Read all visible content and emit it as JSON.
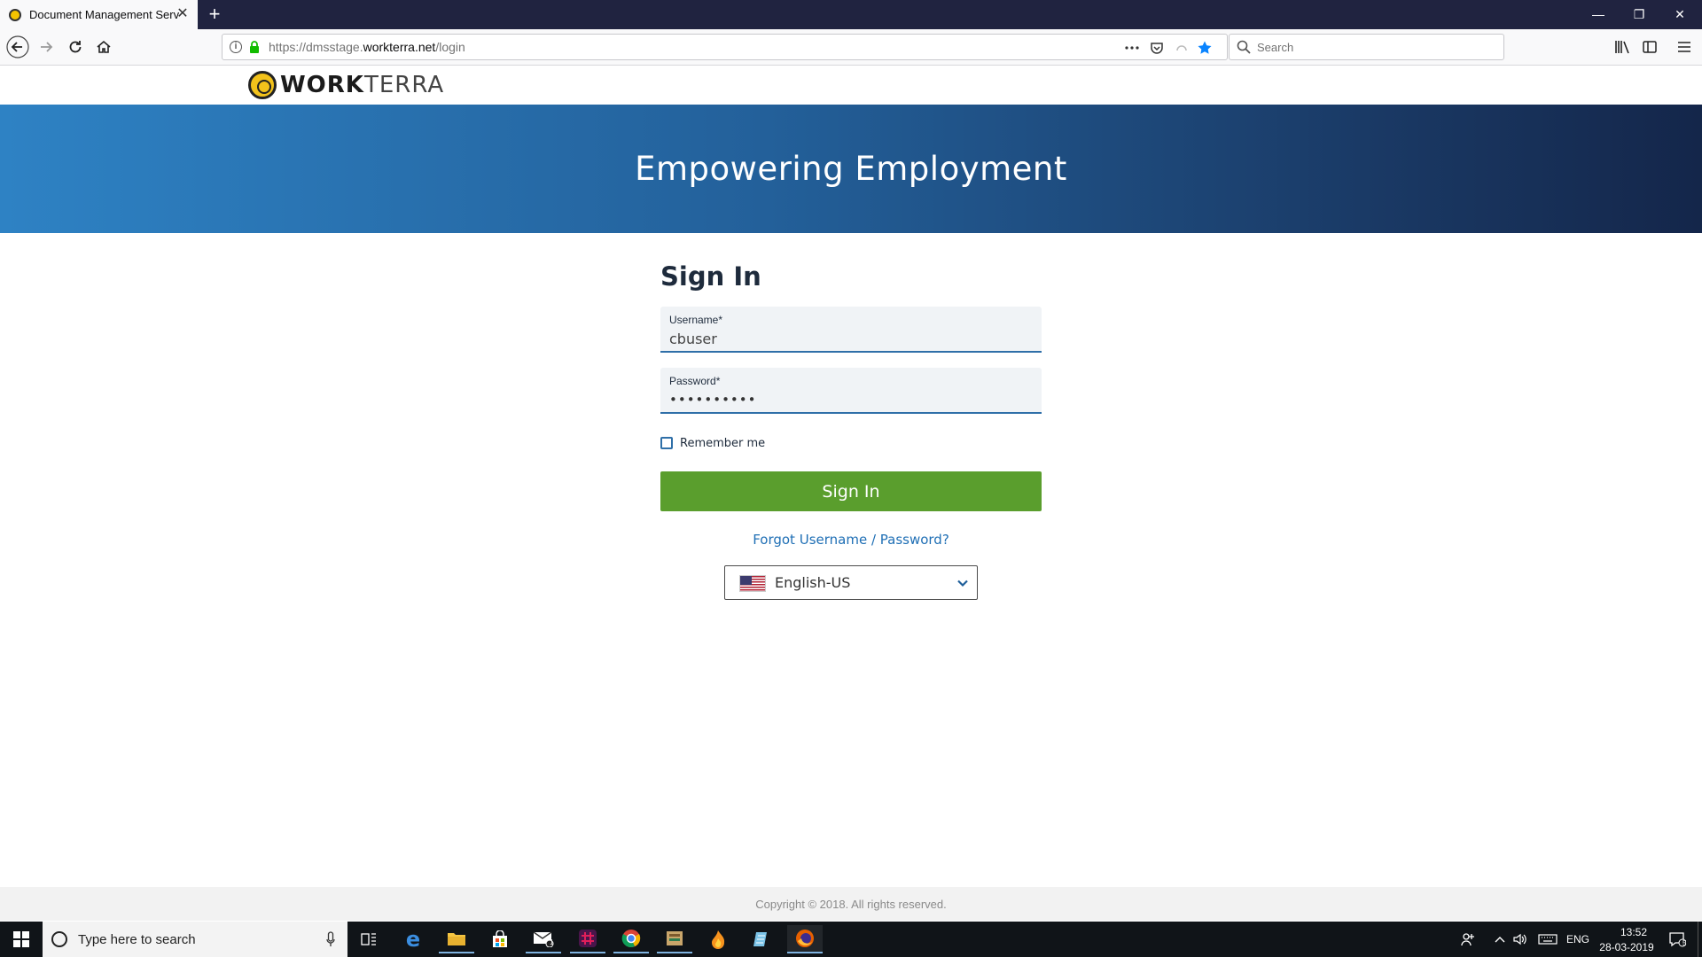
{
  "browser": {
    "tab_title": "Document Management Servic",
    "url_prefix": "https://dmsstage.",
    "url_host": "workterra.net",
    "url_path": "/login",
    "search_placeholder": "Search"
  },
  "site": {
    "logo_bold": "WORK",
    "logo_light": "TERRA",
    "banner_title": "Empowering Employment"
  },
  "signin": {
    "heading": "Sign In",
    "username_label": "Username*",
    "username_value": "cbuser",
    "password_label": "Password*",
    "password_value": "••••••••••",
    "remember_label": "Remember me",
    "remember_checked": false,
    "button_label": "Sign In",
    "forgot_link": "Forgot Username / Password?",
    "language": "English-US"
  },
  "footer": {
    "copyright": "Copyright © 2018. All rights reserved."
  },
  "taskbar": {
    "search_placeholder": "Type here to search",
    "language": "ENG",
    "time": "13:52",
    "date": "28-03-2019",
    "notifications": "5",
    "mail_badge": "1"
  },
  "colors": {
    "banner_start": "#2e82c4",
    "banner_end": "#14264a",
    "signin_button": "#5a9e2d",
    "link": "#1f6fb5"
  }
}
